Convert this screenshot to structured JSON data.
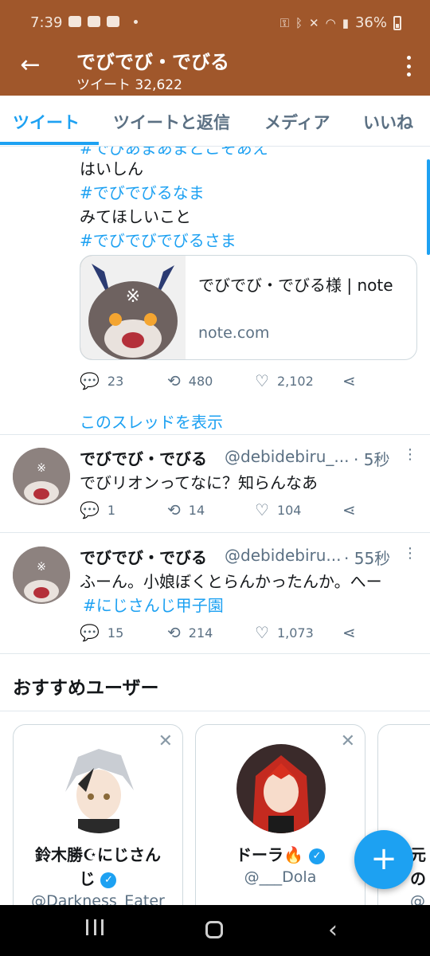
{
  "status_bar": {
    "time": "7:39",
    "battery": "36%"
  },
  "header": {
    "title": "でびでび・でびる",
    "subtitle": "ツイート 32,622"
  },
  "tabs": [
    {
      "label": "ツイート",
      "active": true
    },
    {
      "label": "ツイートと返信",
      "active": false
    },
    {
      "label": "メディア",
      "active": false
    },
    {
      "label": "いいね",
      "active": false
    }
  ],
  "tweet1": {
    "partial_top": "#でびあまあまとこそあえ",
    "lines": [
      "はいしん",
      "#でびでびるなま",
      "みてほしいこと",
      "#でびでびでびるさま"
    ],
    "card": {
      "title": "でびでび・でびる様 | note",
      "domain": "note.com"
    },
    "replies": "23",
    "retweets": "480",
    "likes": "2,102"
  },
  "thread_link": "このスレッドを表示",
  "tweet2": {
    "name": "でびでび・でびる",
    "handle": "@debidebiru_...",
    "time": "· 5秒",
    "text": "でびリオンってなに？知らんなあ",
    "replies": "1",
    "retweets": "14",
    "likes": "104"
  },
  "tweet3": {
    "name": "でびでび・でびる",
    "handle": "@debidebiru...",
    "time": "· 55秒",
    "text": "ふーん。小娘ぼくとらんかったんか。へー",
    "hashtag": "#にじさんじ甲子園",
    "replies": "15",
    "retweets": "214",
    "likes": "1,073"
  },
  "recommendations": {
    "title": "おすすめユーザー",
    "users": [
      {
        "name_line1": "鈴木勝☪にじさん",
        "name_line2": "じ",
        "handle": "@Darkness_Eater"
      },
      {
        "name": "ドーラ🔥",
        "handle": "@___Dola"
      },
      {
        "name_partial": "元",
        "name_partial2": "の",
        "handle_partial": "@"
      }
    ]
  },
  "colors": {
    "header_bg": "#a0572b",
    "accent": "#1da1f2"
  }
}
